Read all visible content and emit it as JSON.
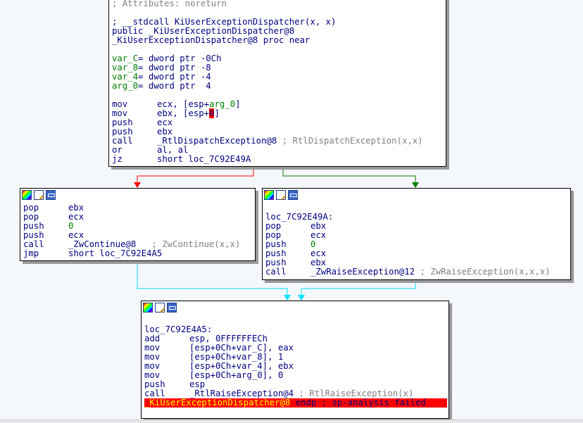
{
  "colors": {
    "edge_false": "#ff0000",
    "edge_true": "#008000",
    "edge_merge": "#00e0ff",
    "highlight": "#ff0000"
  },
  "icons": [
    "color-icon",
    "rename-icon",
    "graph-icon"
  ],
  "top_block": {
    "attr_line": "; Attributes: noreturn",
    "cc_line": "; __stdcall KiUserExceptionDispatcher(x, x)",
    "public_line": "public _KiUserExceptionDispatcher@8",
    "proc_line": "_KiUserExceptionDispatcher@8 proc near",
    "vars": [
      {
        "name": "var_C",
        "rest": "= dword ptr -0Ch"
      },
      {
        "name": "var_8",
        "rest": "= dword ptr -8"
      },
      {
        "name": "var_4",
        "rest": "= dword ptr -4"
      },
      {
        "name": "arg_0",
        "rest": "= dword ptr  4"
      }
    ],
    "ins": [
      {
        "mn": "mov",
        "op": "ecx, [esp+",
        "arg": "arg_0",
        "tail": "]"
      },
      {
        "mn": "mov",
        "op": "ebx, [esp+",
        "hl": "0",
        "tail": "]"
      },
      {
        "mn": "push",
        "op": "ecx"
      },
      {
        "mn": "push",
        "op": "ebx"
      },
      {
        "mn": "call",
        "op": "_RtlDispatchException@8",
        "cmt": " ; RtlDispatchException(x,x)"
      },
      {
        "mn": "or",
        "op": "al, al"
      },
      {
        "mn": "jz",
        "op": "short loc_7C92E49A"
      }
    ]
  },
  "left_block": {
    "ins": [
      {
        "mn": "pop",
        "op": "ebx"
      },
      {
        "mn": "pop",
        "op": "ecx"
      },
      {
        "mn": "push",
        "op": "0",
        "arg": true
      },
      {
        "mn": "push",
        "op": "ecx"
      },
      {
        "mn": "call",
        "op": "_ZwContinue@8",
        "cmt": "   ; ZwContinue(x,x)"
      },
      {
        "mn": "jmp",
        "op": "short loc_7C92E4A5"
      }
    ]
  },
  "right_block": {
    "label": "loc_7C92E49A:",
    "ins": [
      {
        "mn": "pop",
        "op": "ebx"
      },
      {
        "mn": "pop",
        "op": "ecx"
      },
      {
        "mn": "push",
        "op": "0",
        "arg": true
      },
      {
        "mn": "push",
        "op": "ecx"
      },
      {
        "mn": "push",
        "op": "ebx"
      },
      {
        "mn": "call",
        "op": "_ZwRaiseException@12",
        "cmt": " ; ZwRaiseException(x,x,x)"
      }
    ]
  },
  "bottom_block": {
    "label": "loc_7C92E4A5:",
    "ins": [
      {
        "mn": "add",
        "op": "esp, 0FFFFFFECh"
      },
      {
        "mn": "mov",
        "op": "[esp+0Ch+var_C], eax"
      },
      {
        "mn": "mov",
        "op": "[esp+0Ch+var_8], 1"
      },
      {
        "mn": "mov",
        "op": "[esp+0Ch+var_4], ebx"
      },
      {
        "mn": "mov",
        "op": "[esp+0Ch+arg_0], 0"
      },
      {
        "mn": "push",
        "op": "esp"
      },
      {
        "mn": "call",
        "op": "_RtlRaiseException@4",
        "cmt": " ; RtlRaiseException(x)"
      }
    ],
    "endp_name": "_KiUserExceptionDispatcher@8",
    "endp_rest": " endp ; sp-analysis failed"
  }
}
